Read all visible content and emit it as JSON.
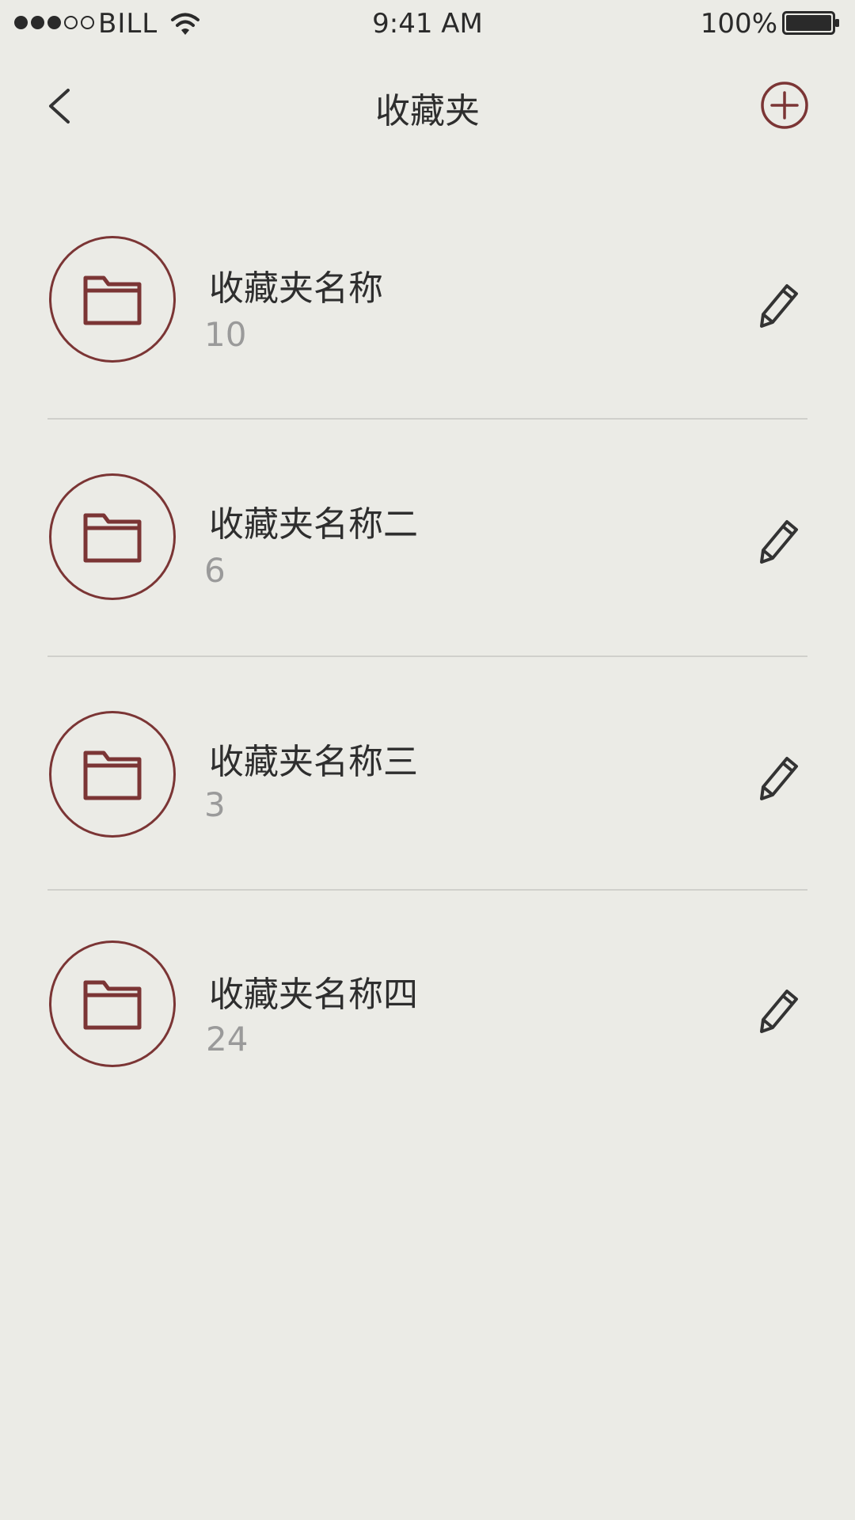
{
  "status_bar": {
    "carrier": "BILL",
    "time": "9:41 AM",
    "battery": "100%"
  },
  "nav": {
    "title": "收藏夹",
    "icons": {
      "back": "chevron-left-icon",
      "add": "plus-circle-icon"
    }
  },
  "folders": [
    {
      "name": "收藏夹名称",
      "count": "10"
    },
    {
      "name": "收藏夹名称二",
      "count": "6"
    },
    {
      "name": "收藏夹名称三",
      "count": "3"
    },
    {
      "name": "收藏夹名称四",
      "count": "24"
    }
  ],
  "colors": {
    "accent": "#7b3535",
    "background": "#ebebe6",
    "text": "#2e2e2e",
    "secondary_text": "#9a9a9a"
  }
}
